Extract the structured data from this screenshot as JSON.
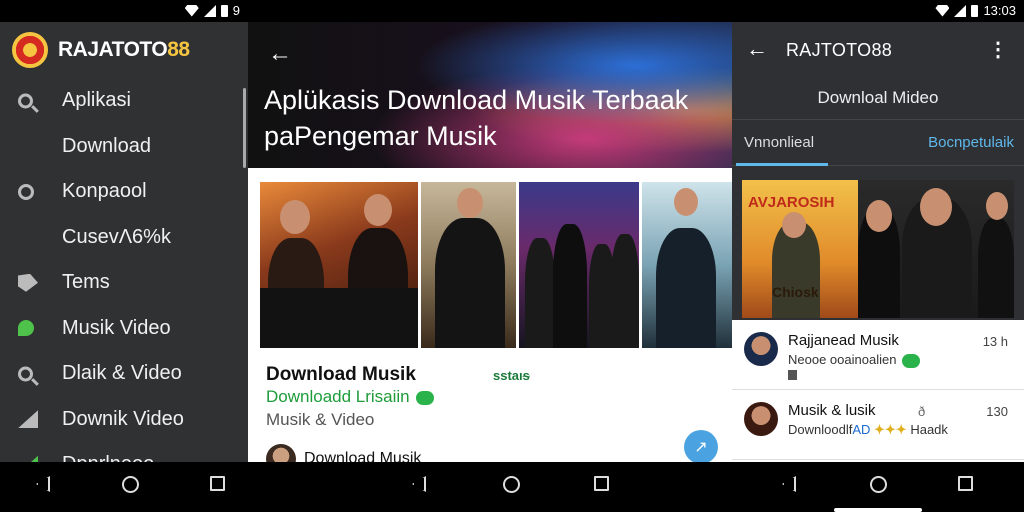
{
  "screen1": {
    "status_text": "9",
    "brand": {
      "prefix": "RAJATOTO",
      "suffix": "88"
    },
    "menu": [
      {
        "label": "Aplikasi",
        "icon": "search-icon"
      },
      {
        "label": "Download",
        "icon": ""
      },
      {
        "label": "Konpaool",
        "icon": "chat-icon"
      },
      {
        "label": "CusevΛ6%k",
        "icon": ""
      },
      {
        "label": "Tems",
        "icon": "heart-icon"
      },
      {
        "label": "Musik Video",
        "icon": "music-icon"
      },
      {
        "label": "Dlaik & Video",
        "icon": "search-icon"
      },
      {
        "label": "Downik Video",
        "icon": "play-icon"
      },
      {
        "label": "Dpnrlneoo",
        "icon": "download-icon"
      }
    ]
  },
  "screen2": {
    "hero_title": "Aplükasis Download Musik Terbaak paPengemar Musik",
    "card_title": "Download Musik",
    "card_subtitle": "Downloadd Lrisaiin",
    "card_meta": "Musik & Video",
    "card_logo": "sstaıᵴ",
    "author": "Download Musik",
    "fab_icon": "↗"
  },
  "screen3": {
    "status_time": "13:03",
    "title": "RAJTOTO88",
    "subtitle": "Downloal Mideo",
    "tab_active": "Vnnonlieal",
    "tab_other": "Bocnpetulaik",
    "album_title": "AVJAROSIH",
    "album_title2": "Chiosk",
    "rows": [
      {
        "name": "Rajjanead Musik",
        "sub": "Neooe ooainoalien",
        "time": "13 h"
      },
      {
        "name": "Musik & lusik",
        "sub_a": "Downloodlf",
        "sub_b": "AD",
        "sub_c": "Haadk",
        "time": "130",
        "badge": "ð"
      }
    ]
  },
  "colors": {
    "accent_green": "#2ab34a",
    "accent_blue": "#5fb8ea",
    "brand_yellow": "#f5c542"
  }
}
